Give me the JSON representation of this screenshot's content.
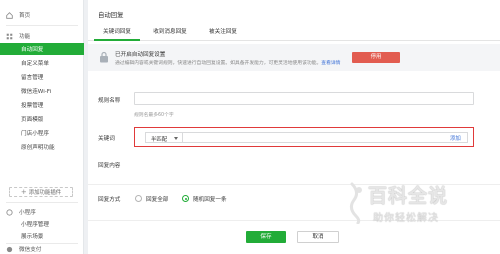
{
  "sidebar": {
    "home": "首页",
    "functions": "功能",
    "items": [
      "自动回复",
      "自定义菜单",
      "留言管理",
      "微信连Wi-Fi",
      "投票管理",
      "页面模版",
      "门店小程序",
      "原创声明功能"
    ],
    "add_plugin": "添加功能插件",
    "mini_program": "小程序",
    "mini_items": [
      "小程序管理",
      "展示场景"
    ],
    "wechat_pay": "微信支付"
  },
  "main": {
    "title": "自动回复",
    "tabs": [
      "关键词回复",
      "收到消息回复",
      "被关注回复"
    ],
    "notice": {
      "title": "已开启自动回复设置",
      "desc": "通过编辑内容或关键词规则，快速进行自动回复设置。如具备开发能力，可更灵活地使用该功能。",
      "link": "查看详情"
    },
    "disable_button": "停用",
    "rule_label": "规则名称",
    "rule_hint": "规则名最多60个字",
    "keyword_label": "关键词",
    "match_mode": "半匹配",
    "add_link": "添加",
    "reply_content_label": "回复内容",
    "reply_mode_label": "回复方式",
    "reply_mode_options": [
      "回复全部",
      "随机回复一条"
    ],
    "selected_reply_mode": "随机回复一条",
    "save": "保存",
    "cancel": "取消"
  },
  "watermark": {
    "title": "百科全说",
    "subtitle": "助你轻松解决"
  },
  "colors": {
    "accent": "#22ac38",
    "danger": "#e25c50",
    "highlight_box": "#e03a3a",
    "link": "#3a6fd6"
  }
}
